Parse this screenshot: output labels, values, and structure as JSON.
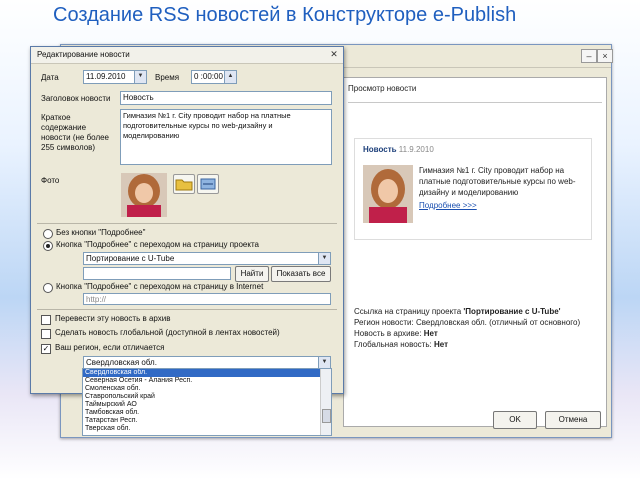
{
  "slide_title": "Создание RSS новостей в Конструкторе e-Publish",
  "bg_window": {
    "preview_label": "Просмотр новости",
    "card_title": "Новость",
    "card_date": "11.9.2010",
    "card_text": "Гимназия №1 г. City проводит набор на платные подготовительные курсы по web-дизайну и моделированию",
    "card_link": "Подробнее >>>",
    "info_line1_prefix": "Ссылка на страницу проекта ",
    "info_line1_bold": "'Портирование с U-Tube'",
    "info_line2": "Регион новости: Свердловская обл. (отличный от основного)",
    "info_line3_prefix": "Новость в архиве: ",
    "info_line3_bold": "Нет",
    "info_line4_prefix": "Глобальная новость: ",
    "info_line4_bold": "Нет",
    "ok_label": "OK",
    "cancel_label": "Отмена"
  },
  "dialog": {
    "title": "Редактирование новости",
    "date_label": "Дата",
    "date_value": "11.09.2010",
    "time_label": "Время",
    "time_value": "0 :00:00",
    "headline_label": "Заголовок новости",
    "headline_value": "Новость",
    "summary_label": "Краткое содержание новости (не более 255 символов)",
    "summary_value": "Гимназия №1 г. City проводит набор на платные подготовительные курсы по web-дизайну и моделированию",
    "photo_label": "Фото",
    "opt_no_button": "Без кнопки \"Подробнее\"",
    "opt_project": "Кнопка \"Подробнее\" с переходом на страницу проекта",
    "project_value": "Портирование с U-Tube",
    "find_label": "Найти",
    "show_all_label": "Показать все",
    "opt_internet": "Кнопка \"Подробнее\" с переходом на страницу в Internet",
    "url_placeholder": "http://",
    "cb_archive": "Перевести эту новость в архив",
    "cb_global": "Сделать новость глобальной (доступной в лентах новостей)",
    "cb_region": "Ваш регион, если отличается",
    "region_value": "Свердловская обл.",
    "region_options": [
      "Свердловская обл.",
      "Северная Осетия - Алания Респ.",
      "Смоленская обл.",
      "Ставропольский край",
      "Таймырский АО",
      "Тамбовская обл.",
      "Татарстан Респ.",
      "Тверская обл."
    ]
  }
}
